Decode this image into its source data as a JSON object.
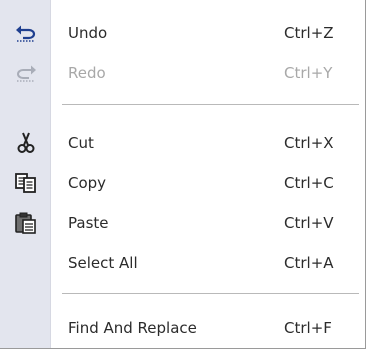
{
  "menu": {
    "items": [
      {
        "label": "Undo",
        "shortcut": "Ctrl+Z",
        "icon": "undo-icon",
        "enabled": true
      },
      {
        "label": "Redo",
        "shortcut": "Ctrl+Y",
        "icon": "redo-icon",
        "enabled": false
      },
      {
        "label": "Cut",
        "shortcut": "Ctrl+X",
        "icon": "cut-icon",
        "enabled": true
      },
      {
        "label": "Copy",
        "shortcut": "Ctrl+C",
        "icon": "copy-icon",
        "enabled": true
      },
      {
        "label": "Paste",
        "shortcut": "Ctrl+V",
        "icon": "paste-icon",
        "enabled": true
      },
      {
        "label": "Select All",
        "shortcut": "Ctrl+A",
        "icon": "",
        "enabled": true
      },
      {
        "label": "Find And Replace",
        "shortcut": "Ctrl+F",
        "icon": "",
        "enabled": true
      }
    ],
    "colors": {
      "gutter": "#e3e5ee",
      "text": "#2b2b2b",
      "disabled_text": "#a8a8a8",
      "icon_blue": "#1f3f8f"
    }
  }
}
